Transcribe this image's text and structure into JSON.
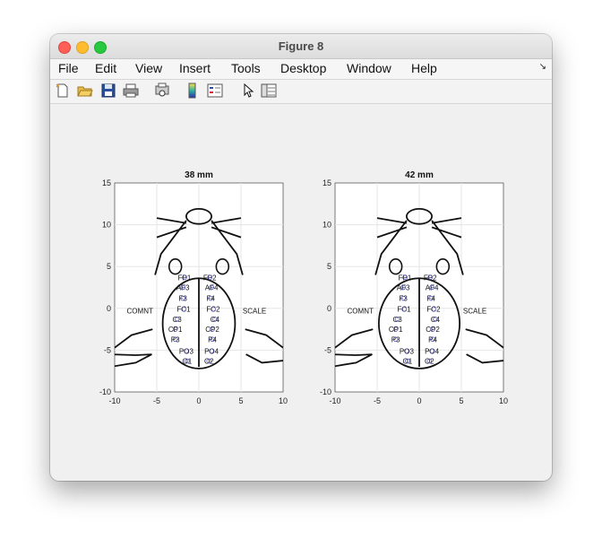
{
  "window": {
    "title": "Figure 8"
  },
  "menu": [
    "File",
    "Edit",
    "View",
    "Insert",
    "Tools",
    "Desktop",
    "Window",
    "Help"
  ],
  "menu_overflow_icon": "arrow-down-right-icon",
  "toolbar": [
    {
      "name": "new-figure-icon"
    },
    {
      "name": "open-file-icon"
    },
    {
      "name": "save-icon"
    },
    {
      "name": "print-icon"
    },
    {
      "name": "print-preview-icon"
    },
    {
      "name": "colorbar-icon"
    },
    {
      "name": "legend-icon"
    },
    {
      "name": "pointer-icon"
    },
    {
      "name": "property-editor-icon"
    }
  ],
  "plots": [
    {
      "title": "38 mm",
      "xticks": [
        "-10",
        "-5",
        "0",
        "5",
        "10"
      ],
      "yticks": [
        "15",
        "10",
        "5",
        "0",
        "-5",
        "-10"
      ],
      "labels": [
        "COMNT",
        "SCALE",
        "FP1",
        "FP2",
        "AF3",
        "AF4",
        "F3",
        "F4",
        "FC1",
        "FC2",
        "C3",
        "C4",
        "CP1",
        "CP2",
        "P3",
        "P4",
        "PO3",
        "PO4",
        "O1",
        "O2"
      ]
    },
    {
      "title": "42 mm",
      "xticks": [
        "-10",
        "-5",
        "0",
        "5",
        "10"
      ],
      "yticks": [
        "15",
        "10",
        "5",
        "0",
        "-5",
        "-10"
      ],
      "labels": [
        "COMNT",
        "SCALE",
        "FP1",
        "FP2",
        "AF3",
        "AF4",
        "F3",
        "F4",
        "FC1",
        "FC2",
        "C3",
        "C4",
        "CP1",
        "CP2",
        "P3",
        "P4",
        "PO3",
        "PO4",
        "O1",
        "O2"
      ]
    }
  ]
}
